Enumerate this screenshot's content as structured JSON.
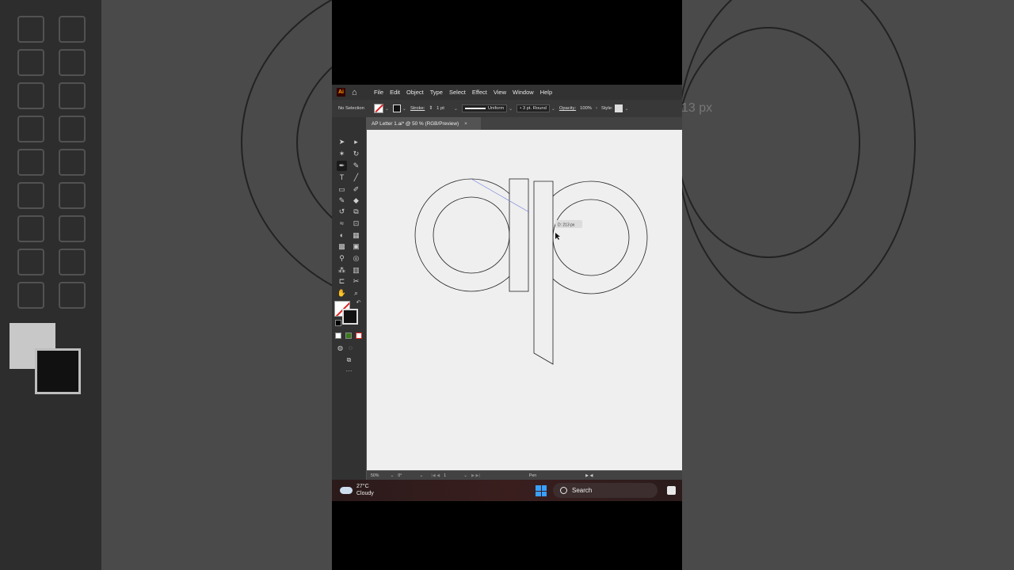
{
  "app": {
    "logo": "Ai",
    "menu": [
      "File",
      "Edit",
      "Object",
      "Type",
      "Select",
      "Effect",
      "View",
      "Window",
      "Help"
    ]
  },
  "control_bar": {
    "selection": "No Selection",
    "stroke_label": "Stroke:",
    "stroke_weight": "1 pt",
    "profile": "Uniform",
    "brush": "3 pt. Round",
    "opacity_label": "Opacity:",
    "opacity": "100%",
    "style_label": "Style:"
  },
  "document_tab": {
    "title": "AP Letter 1.ai* @ 50 % (RGB/Preview)",
    "close": "×"
  },
  "canvas": {
    "tooltip": "D: 213 px"
  },
  "status_bar": {
    "zoom": "50%",
    "rotation": "0°",
    "artboard": "1",
    "tool": "Pen"
  },
  "taskbar": {
    "temperature": "27°C",
    "weather": "Cloudy",
    "search_label": "Search"
  },
  "background": {
    "measure_label": "13 px"
  },
  "colors": {
    "panel_dark": "#323232",
    "canvas": "#efefef",
    "accent_windows": "#3aa0ff",
    "none_swatch_line": "#dd2222"
  },
  "icons": [
    "home-icon",
    "selection-tool-icon",
    "direct-selection-icon",
    "pen-tool-icon",
    "type-tool-icon",
    "line-tool-icon",
    "rectangle-tool-icon",
    "paintbrush-icon",
    "rotate-icon",
    "scale-icon",
    "hand-icon",
    "zoom-icon",
    "windows-start-icon",
    "search-icon",
    "cloud-icon"
  ]
}
